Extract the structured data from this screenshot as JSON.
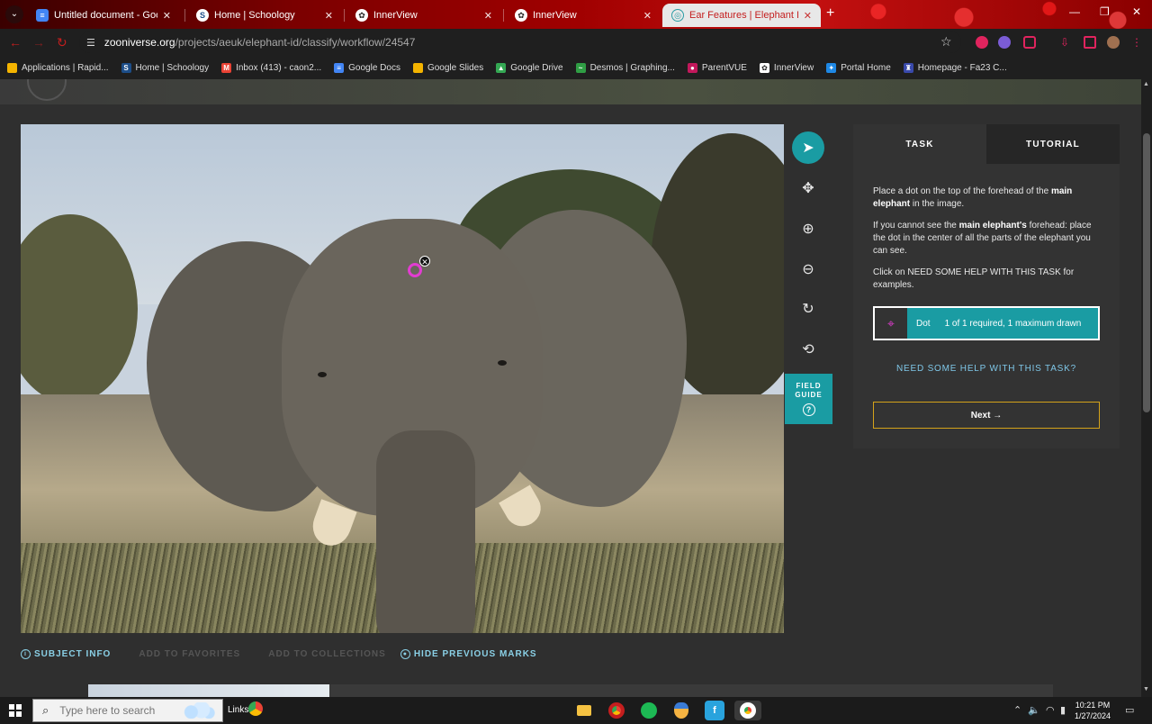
{
  "browser": {
    "tabs": [
      {
        "label": "Untitled document - Google Do",
        "icon": "docs-icon",
        "color": "#4285f4",
        "glyph": "≡"
      },
      {
        "label": "Home | Schoology",
        "icon": "schoology-icon",
        "color": "#1d4e89",
        "glyph": "S"
      },
      {
        "label": "InnerView",
        "icon": "innerview-icon",
        "color": "#ffffff",
        "glyph": "✿"
      },
      {
        "label": "InnerView",
        "icon": "innerview-icon",
        "color": "#ffffff",
        "glyph": "✿"
      },
      {
        "label": "Ear Features | Elephant ID | Zo",
        "icon": "zooniverse-icon",
        "color": "#2a9ca4",
        "glyph": "◎"
      }
    ],
    "close_glyph": "✕",
    "new_tab_glyph": "+",
    "window_controls": {
      "minimize": "—",
      "restore": "❐",
      "close": "✕"
    },
    "address": {
      "domain": "zooniverse.org",
      "path": "/projects/aeuk/elephant-id/classify/workflow/24547"
    },
    "bookmarks": [
      {
        "label": "Applications | Rapid...",
        "color": "#f4b400",
        "glyph": ""
      },
      {
        "label": "Home | Schoology",
        "color": "#1d4e89",
        "glyph": "S"
      },
      {
        "label": "Inbox (413) - caon2...",
        "color": "#ea4335",
        "glyph": "M"
      },
      {
        "label": "Google Docs",
        "color": "#4285f4",
        "glyph": "≡"
      },
      {
        "label": "Google Slides",
        "color": "#f4b400",
        "glyph": ""
      },
      {
        "label": "Google Drive",
        "color": "#34a853",
        "glyph": "▲"
      },
      {
        "label": "Desmos | Graphing...",
        "color": "#2f9e44",
        "glyph": "~"
      },
      {
        "label": "ParentVUE",
        "color": "#c2185b",
        "glyph": "●"
      },
      {
        "label": "InnerView",
        "color": "#ffffff",
        "glyph": "✿"
      },
      {
        "label": "Portal Home",
        "color": "#1e88e5",
        "glyph": "✦"
      },
      {
        "label": "Homepage - Fa23 C...",
        "color": "#3949ab",
        "glyph": "♜"
      }
    ]
  },
  "classifier": {
    "tabs": {
      "task": "TASK",
      "tutorial": "TUTORIAL"
    },
    "instructions": {
      "p1_pre": "Place a dot on the top of the forehead of the ",
      "p1_bold": "main elephant",
      "p1_post": " in the image.",
      "p2_pre": "If you cannot see the ",
      "p2_bold": "main elephant's",
      "p2_post": " forehead: place the dot in the center of all the parts of the elephant you can see.",
      "p3": "Click on NEED SOME HELP WITH THIS TASK for examples."
    },
    "dot_tool": {
      "label": "Dot",
      "status": "1 of 1 required, 1 maximum drawn"
    },
    "help_link": "NEED SOME HELP WITH THIS TASK?",
    "next_button": "Next →",
    "field_guide": {
      "line1": "FIELD",
      "line2": "GUIDE",
      "glyph": "?"
    },
    "tools": [
      "pointer-icon",
      "move-icon",
      "zoom-in-icon",
      "zoom-out-icon",
      "rotate-icon",
      "reset-icon"
    ],
    "tool_glyphs": [
      "➤",
      "✥",
      "⊕",
      "⊖",
      "↻",
      "⟲"
    ],
    "subject_links": [
      {
        "label": "SUBJECT INFO",
        "enabled": true
      },
      {
        "label": "ADD TO FAVORITES",
        "enabled": false
      },
      {
        "label": "ADD TO COLLECTIONS",
        "enabled": false
      },
      {
        "label": "HIDE PREVIOUS MARKS",
        "enabled": true
      }
    ],
    "mark": {
      "remove_glyph": "✕"
    }
  },
  "taskbar": {
    "search_placeholder": "Type here to search",
    "links_label": "Links",
    "time": "10:21 PM",
    "date": "1/27/2024"
  },
  "colors": {
    "teal": "#1a9ca3",
    "mark": "#e23cd1",
    "next_border": "#d4a21a"
  }
}
